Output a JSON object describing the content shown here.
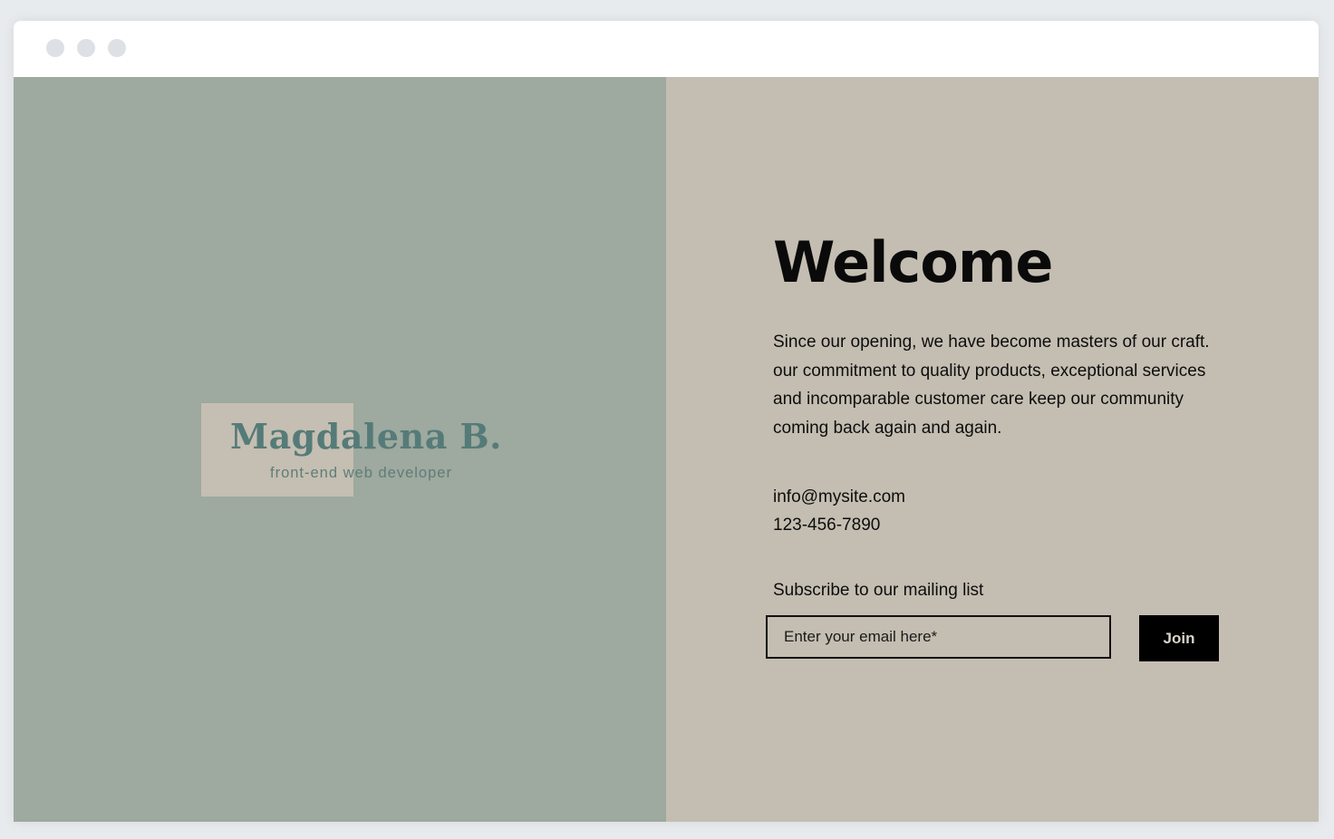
{
  "window": {
    "controls": [
      "close",
      "minimize",
      "maximize"
    ]
  },
  "logo": {
    "name": "Magdalena B.",
    "tagline": "front-end web developer"
  },
  "main": {
    "heading": "Welcome",
    "intro": "Since our opening, we have become masters of our craft. our commitment to quality products, exceptional services and incomparable customer care keep our community coming back again and again.",
    "email": "info@mysite.com",
    "phone": "123-456-7890"
  },
  "subscribe": {
    "label": "Subscribe to our mailing list",
    "email_placeholder": "Enter your email here*",
    "email_value": "",
    "button_label": "Join"
  },
  "colors": {
    "left_panel": "#9ea99f",
    "right_panel": "#c4beb2",
    "logo_box": "#c5beb2",
    "logo_text": "#557b78",
    "button_bg": "#000000"
  }
}
